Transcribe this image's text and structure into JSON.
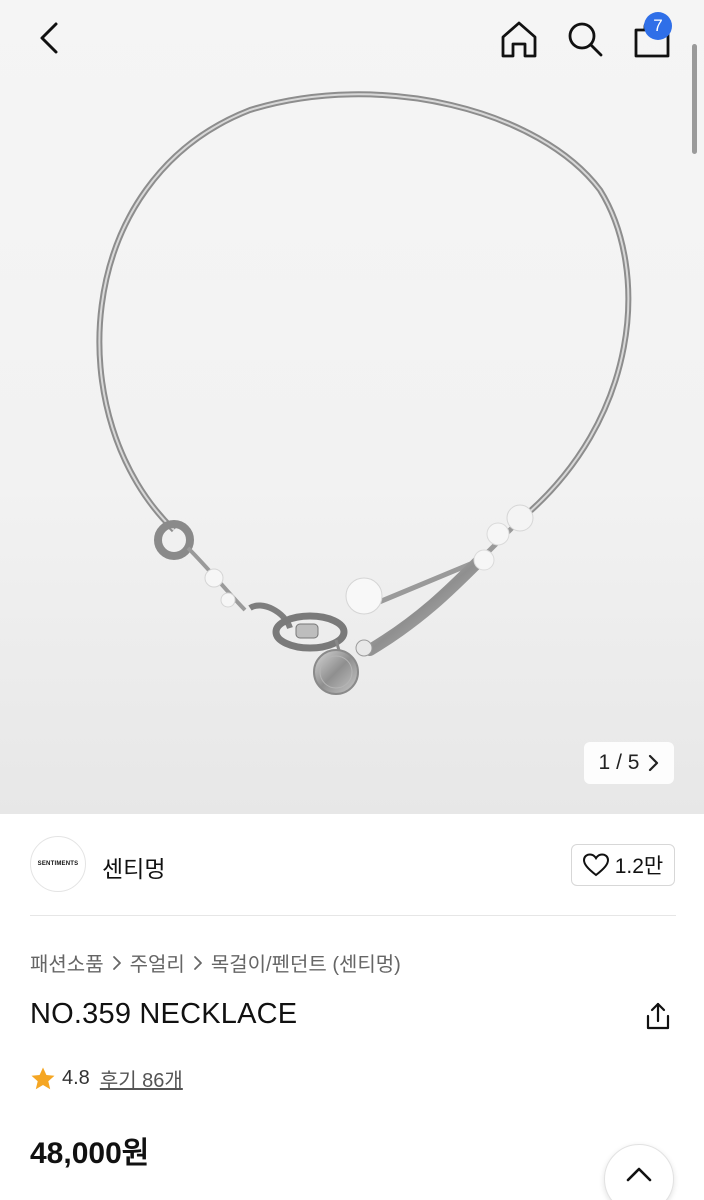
{
  "gallery": {
    "current": "1",
    "separator": "/",
    "total": "5",
    "image_alt": "NO.359 NECKLACE"
  },
  "header": {
    "cart_count": "7",
    "icons": [
      "back-arrow-icon",
      "home-icon",
      "search-icon",
      "shopping-bag-icon"
    ]
  },
  "brand": {
    "logo_text": "SENTIMENTS",
    "name": "센티멍",
    "like_count": "1.2만"
  },
  "breadcrumb": [
    "패션소품",
    "주얼리",
    "목걸이/펜던트 (센티멍)"
  ],
  "product": {
    "title": "NO.359 NECKLACE",
    "rating": "4.8",
    "review_label": "후기 86개",
    "price": "48,000원"
  },
  "colors": {
    "badge": "#2f6fe8",
    "star": "#f5a623"
  }
}
